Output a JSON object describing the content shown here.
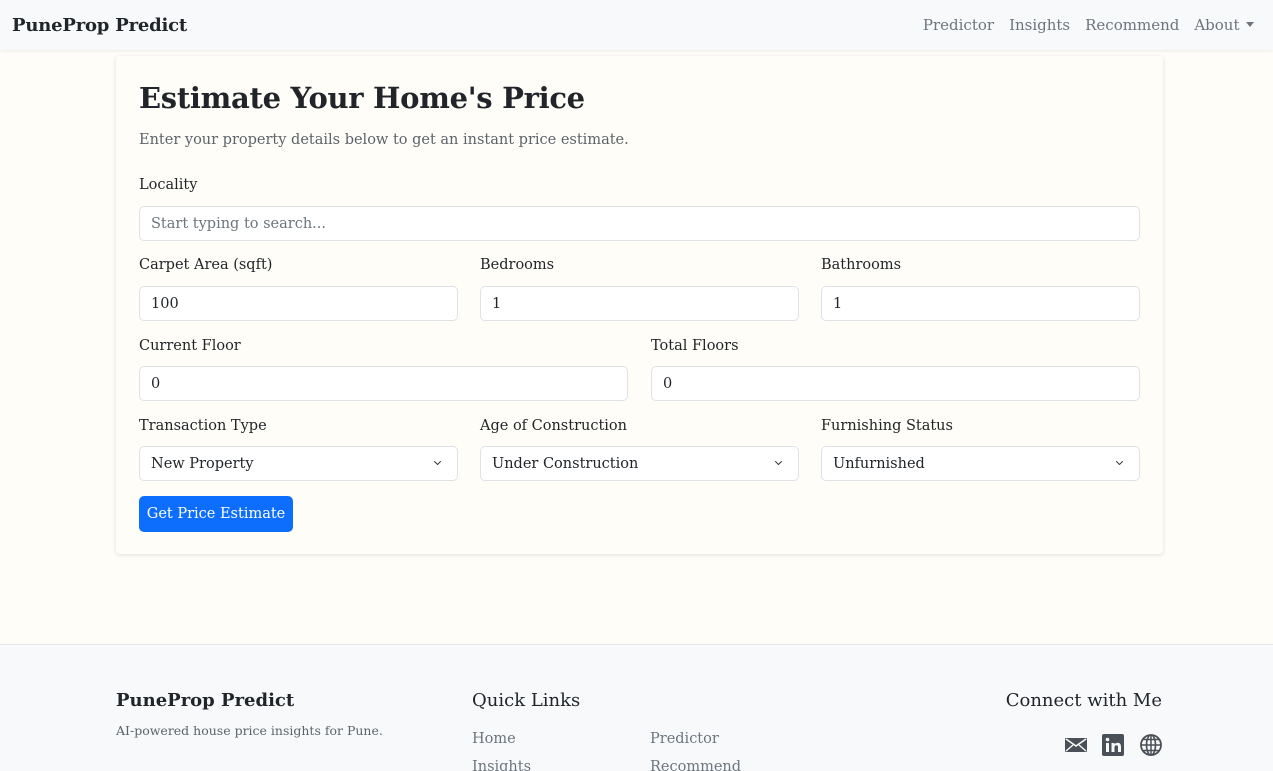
{
  "navbar": {
    "brand": "PuneProp Predict",
    "links": [
      "Predictor",
      "Insights",
      "Recommend",
      "About"
    ]
  },
  "form": {
    "title": "Estimate Your Home's Price",
    "subtitle": "Enter your property details below to get an instant price estimate.",
    "locality": {
      "label": "Locality",
      "placeholder": "Start typing to search...",
      "value": ""
    },
    "carpet_area": {
      "label": "Carpet Area (sqft)",
      "value": "100"
    },
    "bedrooms": {
      "label": "Bedrooms",
      "value": "1"
    },
    "bathrooms": {
      "label": "Bathrooms",
      "value": "1"
    },
    "current_floor": {
      "label": "Current Floor",
      "value": "0"
    },
    "total_floors": {
      "label": "Total Floors",
      "value": "0"
    },
    "transaction_type": {
      "label": "Transaction Type",
      "value": "New Property"
    },
    "age_of_construction": {
      "label": "Age of Construction",
      "value": "Under Construction"
    },
    "furnishing_status": {
      "label": "Furnishing Status",
      "value": "Unfurnished"
    },
    "submit_label": "Get Price Estimate"
  },
  "footer": {
    "brand": "PuneProp Predict",
    "tagline": "AI-powered house price insights for Pune.",
    "quick_links_title": "Quick Links",
    "quick_links": [
      "Home",
      "Predictor",
      "Insights",
      "Recommend"
    ],
    "connect_title": "Connect with Me",
    "social_icons": [
      "email-icon",
      "linkedin-icon",
      "globe-icon"
    ]
  },
  "colors": {
    "primary": "#0d6efd",
    "background": "#fffdf8",
    "navbar": "#f8f9fa",
    "muted_text": "#6c757d"
  }
}
